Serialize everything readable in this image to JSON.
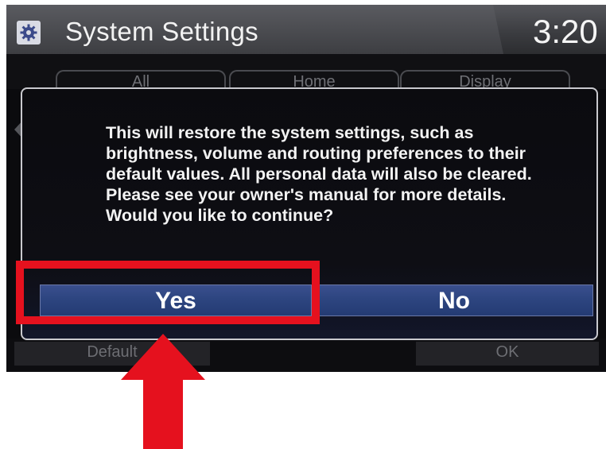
{
  "header": {
    "title": "System Settings",
    "clock": "3:20",
    "settings_icon": "gear-icon"
  },
  "tabs": [
    {
      "label": "All"
    },
    {
      "label": "Home"
    },
    {
      "label": "Display"
    }
  ],
  "dialog": {
    "message_line1": "This will restore the system settings, such as brightness, volume and routing preferences to their default values. All personal data will also be cleared.",
    "message_line2": "Please see your owner's manual for more details. Would you like to continue?",
    "yes_label": "Yes",
    "no_label": "No"
  },
  "footer": {
    "default_label": "Default",
    "ok_label": "OK"
  },
  "colors": {
    "button_blue": "#2d4580",
    "highlight_red": "#e5111e"
  }
}
